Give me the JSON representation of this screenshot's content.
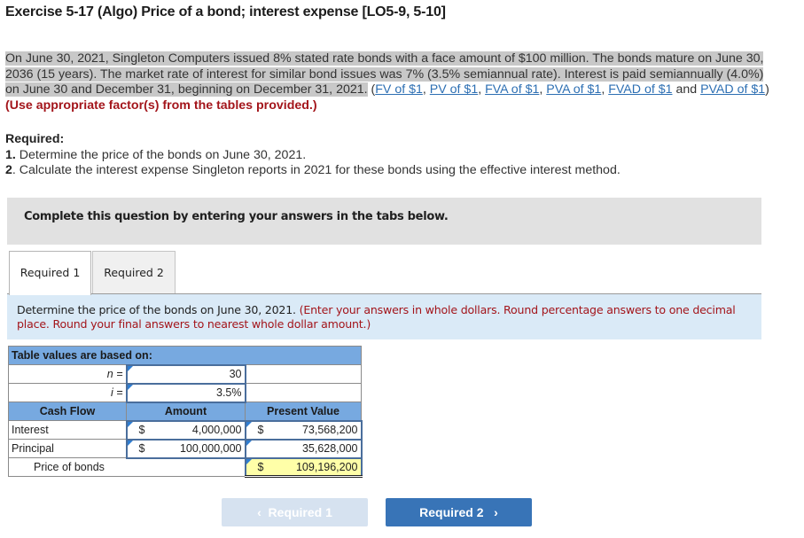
{
  "title": "Exercise 5-17 (Algo) Price of a bond; interest expense [LO5-9, 5-10]",
  "intro": {
    "highlighted": "On June 30, 2021, Singleton Computers issued 8% stated rate bonds with a face amount of $100 million. The bonds mature on June 30, 2036 (15 years). The market rate of interest for similar bond issues was 7% (3.5% semiannual rate). Interest is paid semiannually (4.0%) on June 30 and December 31, beginning on December 31, 2021.",
    "open_paren": " (",
    "links": [
      "FV of $1",
      "PV of $1",
      "FVA of $1",
      "PVA of $1",
      "FVAD of $1",
      "PVAD of $1"
    ],
    "sep": ", ",
    "and": " and ",
    "close_paren": ")",
    "instruction": " (Use appropriate factor(s) from the tables provided.)"
  },
  "required": {
    "heading": "Required:",
    "items": [
      {
        "num": "1.",
        "text": " Determine the price of the bonds on June 30, 2021."
      },
      {
        "num": "2",
        "text": ". Calculate the interest expense Singleton reports in 2021 for these bonds using the effective interest method."
      }
    ]
  },
  "banner": "Complete this question by entering your answers in the tabs below.",
  "tabs": [
    {
      "label": "Required 1",
      "active": true
    },
    {
      "label": "Required 2",
      "active": false
    }
  ],
  "instructions": {
    "text": "Determine the price of the bonds on June 30, 2021.",
    "note": " (Enter your answers in whole dollars. Round percentage answers to one decimal place. Round your final answers to nearest whole dollar amount.)"
  },
  "table": {
    "header": "Table values are based on:",
    "n_label": "n =",
    "n_value": "30",
    "i_label": "i =",
    "i_value": "3.5%",
    "columns": [
      "Cash Flow",
      "Amount",
      "Present Value"
    ],
    "rows": [
      {
        "label": "Interest",
        "amount_symbol": "$",
        "amount": "4,000,000",
        "pv_symbol": "$",
        "pv": "73,568,200"
      },
      {
        "label": "Principal",
        "amount_symbol": "$",
        "amount": "100,000,000",
        "pv_symbol": "",
        "pv": "35,628,000"
      }
    ],
    "total": {
      "label": "Price of bonds",
      "symbol": "$",
      "value": "109,196,200"
    }
  },
  "nav": {
    "prev_label": "Required 1",
    "next_label": "Required 2",
    "prev_icon": "‹",
    "next_icon": "›"
  }
}
